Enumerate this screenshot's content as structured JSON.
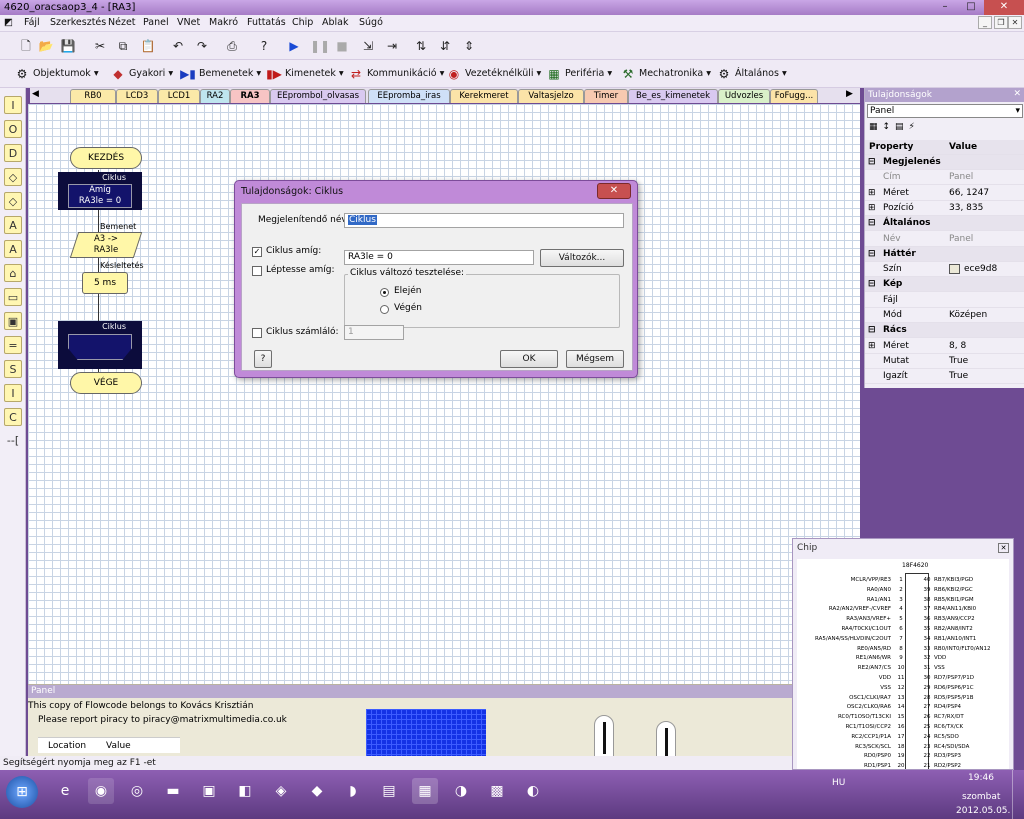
{
  "window": {
    "title": "4620_oracsaop3_4 - [RA3]"
  },
  "menu": [
    "Fájl",
    "Szerkesztés",
    "Nézet",
    "Panel",
    "VNet",
    "Makró",
    "Futtatás",
    "Chip",
    "Ablak",
    "Súgó"
  ],
  "toolbar2": [
    "Objektumok",
    "Gyakori",
    "Bemenetek",
    "Kimenetek",
    "Kommunikáció",
    "Vezetéknélküli",
    "Periféria",
    "Mechatronika",
    "Általános"
  ],
  "tabs": [
    "RB0",
    "LCD3",
    "LCD1",
    "RA2",
    "RA3",
    "EEprombol_olvasas",
    "EEpromba_iras",
    "Kerekmeret",
    "Valtasjelzo",
    "Timer",
    "Be_es_kimenetek",
    "Udvozles",
    "FoFugg..."
  ],
  "flow": {
    "start": "KEZDÉS",
    "loop_label": "Ciklus",
    "loop_amig": "Amíg",
    "loop_cond": "RA3le = 0",
    "input_label": "Bemenet",
    "input_text": "A3 ->\nRA3le",
    "delay_label": "Késleltetés",
    "delay_text": "5 ms",
    "loop_end_label": "Ciklus",
    "end": "VÉGE"
  },
  "dialog": {
    "title": "Tulajdonságok: Ciklus",
    "name_label": "Megjelenítendő név:",
    "name_value": "Ciklus",
    "while_label": "Ciklus amíg:",
    "while_value": "RA3le = 0",
    "variables_btn": "Változók...",
    "step_label": "Léptesse amíg:",
    "test_group": "Ciklus változó tesztelése:",
    "opt_start": "Elején",
    "opt_end": "Végén",
    "counter_label": "Ciklus számláló:",
    "counter_value": "1",
    "help_btn": "?",
    "ok_btn": "OK",
    "cancel_btn": "Mégsem"
  },
  "props": {
    "title": "Tulajdonságok",
    "selected": "Panel",
    "col_property": "Property",
    "col_value": "Value",
    "rows": [
      {
        "k": "Megjelenés",
        "v": "",
        "cat": true,
        "ex": "⊟"
      },
      {
        "k": "Cím",
        "v": "Panel",
        "dim": true
      },
      {
        "k": "Méret",
        "v": "66, 1247",
        "ex": "⊞"
      },
      {
        "k": "Pozíció",
        "v": "33, 835",
        "ex": "⊞"
      },
      {
        "k": "Általános",
        "v": "",
        "cat": true,
        "ex": "⊟"
      },
      {
        "k": "Név",
        "v": "Panel",
        "dim": true
      },
      {
        "k": "Háttér",
        "v": "",
        "cat": true,
        "ex": "⊟"
      },
      {
        "k": "Szín",
        "v": "ece9d8",
        "swatch": "#ece9d8"
      },
      {
        "k": "Kép",
        "v": "",
        "cat": true,
        "ex": "⊟"
      },
      {
        "k": "Fájl",
        "v": ""
      },
      {
        "k": "Mód",
        "v": "Középen"
      },
      {
        "k": "Rács",
        "v": "",
        "cat": true,
        "ex": "⊟"
      },
      {
        "k": "Méret",
        "v": "8, 8",
        "ex": "⊞"
      },
      {
        "k": "Mutat",
        "v": "True"
      },
      {
        "k": "Igazít",
        "v": "True"
      }
    ]
  },
  "panel": {
    "title": "Panel",
    "copy_line": "This copy of Flowcode belongs to Kovács Krisztián",
    "piracy_line": "Please report piracy to piracy@matrixmultimedia.co.uk",
    "col_location": "Location",
    "col_value": "Value"
  },
  "status": "Segítségért nyomja meg az F1 -et",
  "chip": {
    "title": "Chip",
    "name": "18F4620",
    "left_pins": [
      "MCLR/VPP/RE3",
      "RA0/AN0",
      "RA1/AN1",
      "RA2/AN2/VREF-/CVREF",
      "RA3/AN3/VREF+",
      "RA4/T0CKI/C1OUT",
      "RA5/AN4/SS/HLVDIN/C2OUT",
      "RE0/AN5/RD",
      "RE1/AN6/WR",
      "RE2/AN7/CS",
      "VDD",
      "VSS",
      "OSC1/CLKI/RA7",
      "OSC2/CLKO/RA6",
      "RC0/T1OSO/T13CKI",
      "RC1/T1OSI/CCP2",
      "RC2/CCP1/P1A",
      "RC3/SCK/SCL",
      "RD0/PSP0",
      "RD1/PSP1"
    ],
    "right_pins": [
      "RB7/KBI3/PGD",
      "RB6/KBI2/PGC",
      "RB5/KBI1/PGM",
      "RB4/AN11/KBI0",
      "RB3/AN9/CCP2",
      "RB2/AN8/INT2",
      "RB1/AN10/INT1",
      "RB0/INT0/FLT0/AN12",
      "VDD",
      "VSS",
      "RD7/PSP7/P1D",
      "RD6/PSP6/P1C",
      "RD5/PSP5/P1B",
      "RD4/PSP4",
      "RC7/RX/DT",
      "RC6/TX/CK",
      "RC5/SDO",
      "RC4/SDI/SDA",
      "RD3/PSP3",
      "RD2/PSP2"
    ]
  },
  "tray": {
    "lang": "HU",
    "time": "19:46",
    "day": "szombat",
    "date": "2012.05.05."
  }
}
